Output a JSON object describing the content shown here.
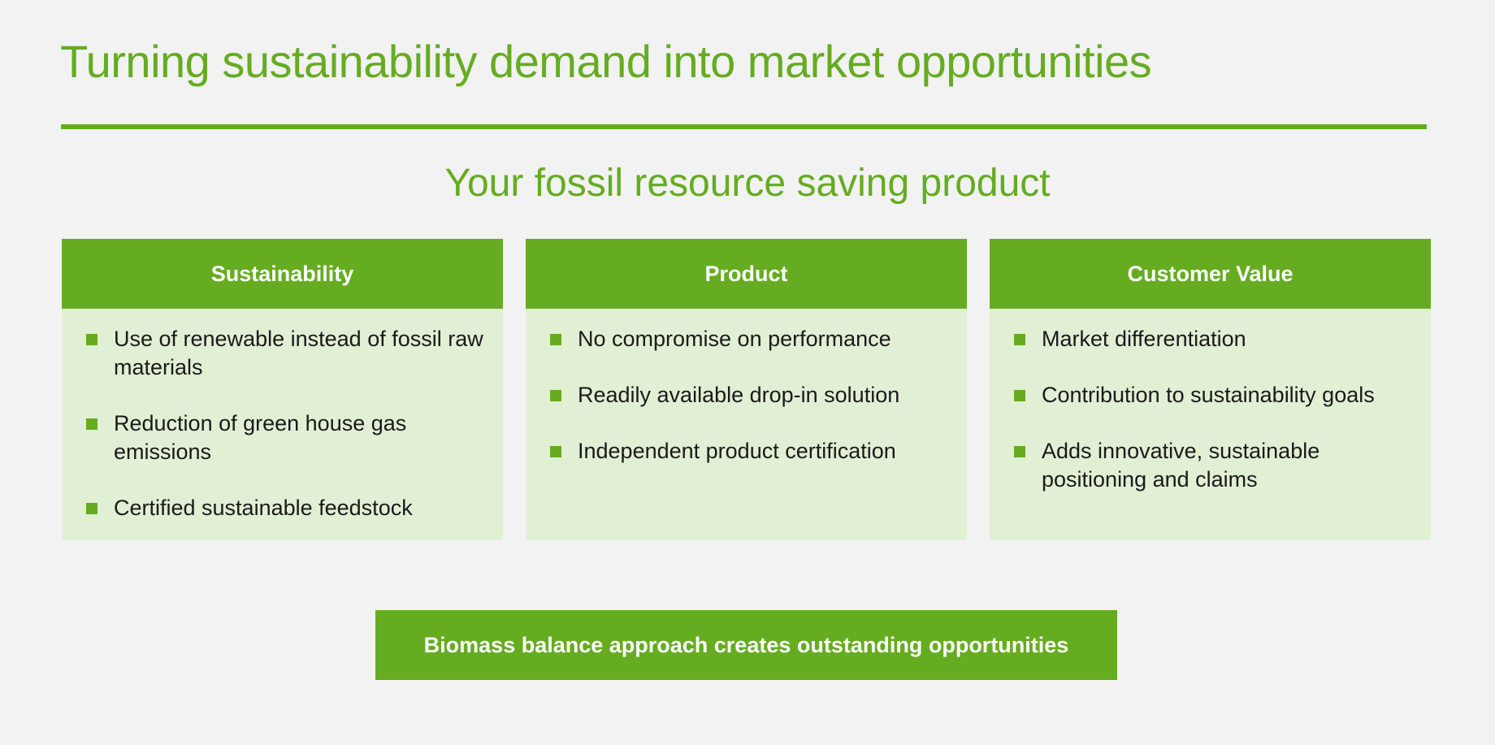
{
  "slide": {
    "title": "Turning sustainability demand into market opportunities",
    "subtitle": "Your fossil resource saving product",
    "accent_color": "#65ac21",
    "panel_color": "#e1efd4",
    "background_color": "#f2f2f2",
    "columns": [
      {
        "header": "Sustainability",
        "items": [
          "Use of renewable instead of fossil raw materials",
          "Reduction of green house gas emissions",
          "Certified sustainable feedstock"
        ]
      },
      {
        "header": "Product",
        "items": [
          "No compromise on performance",
          "Readily available drop-in solution",
          "Independent product certification"
        ]
      },
      {
        "header": "Customer Value",
        "items": [
          "Market differentiation",
          "Contribution to sustainability goals",
          "Adds innovative, sustainable positioning and claims"
        ]
      }
    ],
    "banner": "Biomass balance approach creates outstanding opportunities"
  }
}
